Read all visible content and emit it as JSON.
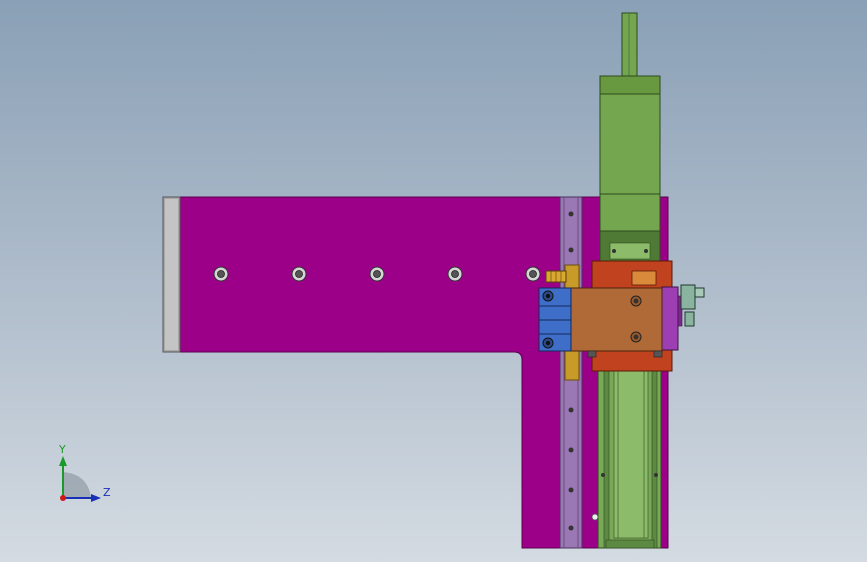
{
  "viewport": {
    "background_top": "#8aa0b6",
    "background_bottom": "#d4dbe2"
  },
  "colors": {
    "plate": "#9c0089",
    "plate_edge": "#5a0050",
    "end_cap": "#a8a8a8",
    "rail": "#9a78b4",
    "motor": "#74a650",
    "motor_dark": "#4e7a35",
    "carriage": "#b06a38",
    "carriage_base": "#c0421e",
    "blue_block": "#3f6ec8",
    "brass": "#c89a28",
    "cylinder": "#78a858"
  },
  "triad": {
    "y_label": "Y",
    "z_label": "Z",
    "icon": "coordinate-triad-icon"
  }
}
